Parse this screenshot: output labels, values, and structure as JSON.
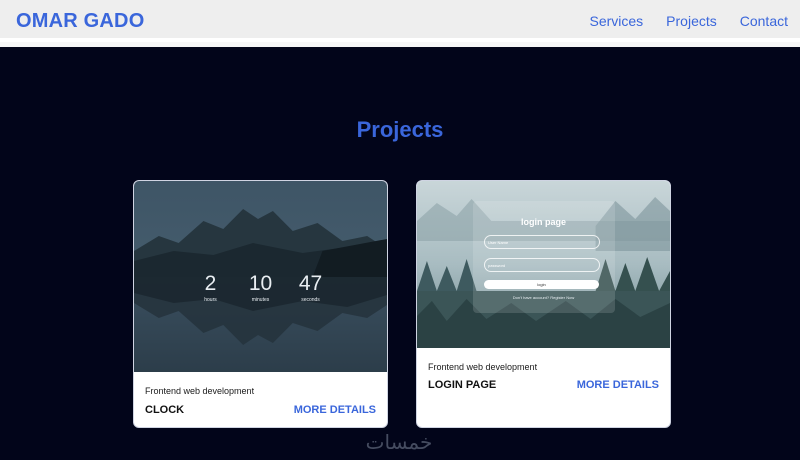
{
  "header": {
    "brand": "OMAR GADO",
    "nav": [
      "Services",
      "Projects",
      "Contact"
    ]
  },
  "projects_section": {
    "title": "Projects",
    "cards": [
      {
        "subtitle": "Frontend web development",
        "title": "CLOCK",
        "link": "MORE DETAILS",
        "preview": {
          "clock": [
            {
              "value": "2",
              "label": "hours"
            },
            {
              "value": "10",
              "label": "minutes"
            },
            {
              "value": "47",
              "label": "seconds"
            }
          ]
        }
      },
      {
        "subtitle": "Frontend web development",
        "title": "LOGIN PAGE",
        "link": "MORE DETAILS",
        "preview": {
          "heading": "login page",
          "user_placeholder": "User Name",
          "pass_placeholder": "password",
          "button": "login",
          "register": "Don't have account? Register Now"
        }
      }
    ]
  },
  "watermark": "خمسات",
  "colors": {
    "accent": "#3a66db",
    "background": "#02051a",
    "navbar": "#eeeeee"
  }
}
